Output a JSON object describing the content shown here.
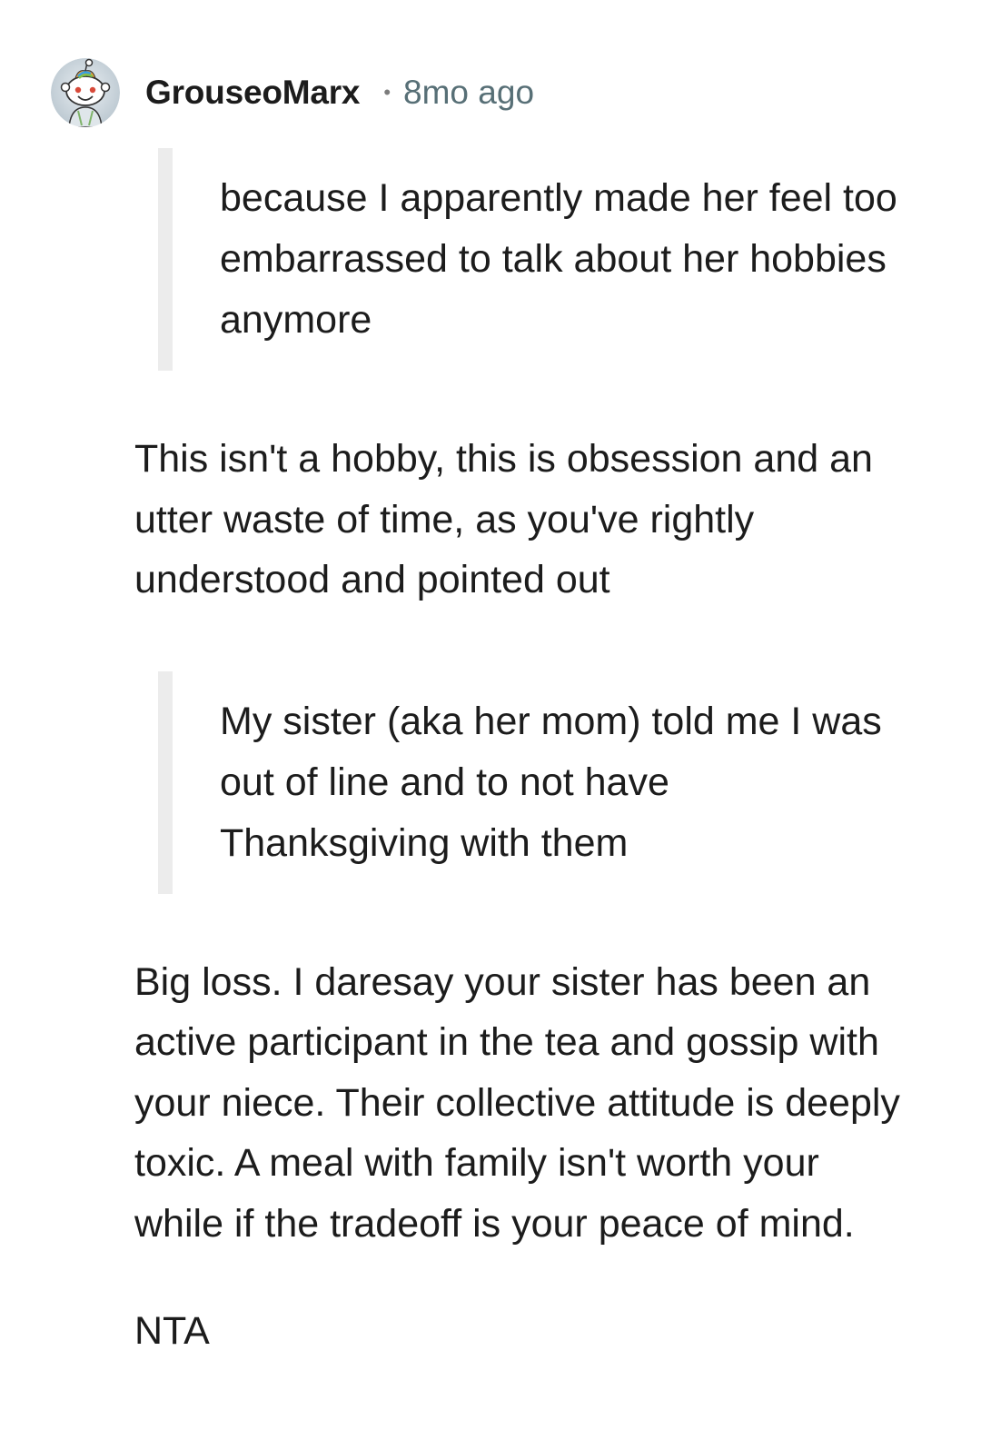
{
  "comment": {
    "author": "GrouseoMarx",
    "separator": "•",
    "timestamp": "8mo ago",
    "avatar_icon": "reddit-snoo-avatar-icon",
    "quotes": [
      "because I apparently made her feel too embarrassed to talk about her hobbies anymore",
      "My sister (aka her mom) told me I was out of line and to not have Thanksgiving with them"
    ],
    "paragraphs": [
      "This isn't a hobby, this is obsession and an utter waste of time, as you've rightly understood and pointed out",
      "Big loss. I daresay your sister has been an active participant in the tea and gossip with your niece. Their collective attitude is deeply toxic. A meal with family isn't worth your while if the tradeoff is your peace of mind.",
      "NTA"
    ]
  },
  "colors": {
    "quote_bar": "#ececec",
    "timestamp": "#576f76",
    "text": "#1c1c1c"
  }
}
